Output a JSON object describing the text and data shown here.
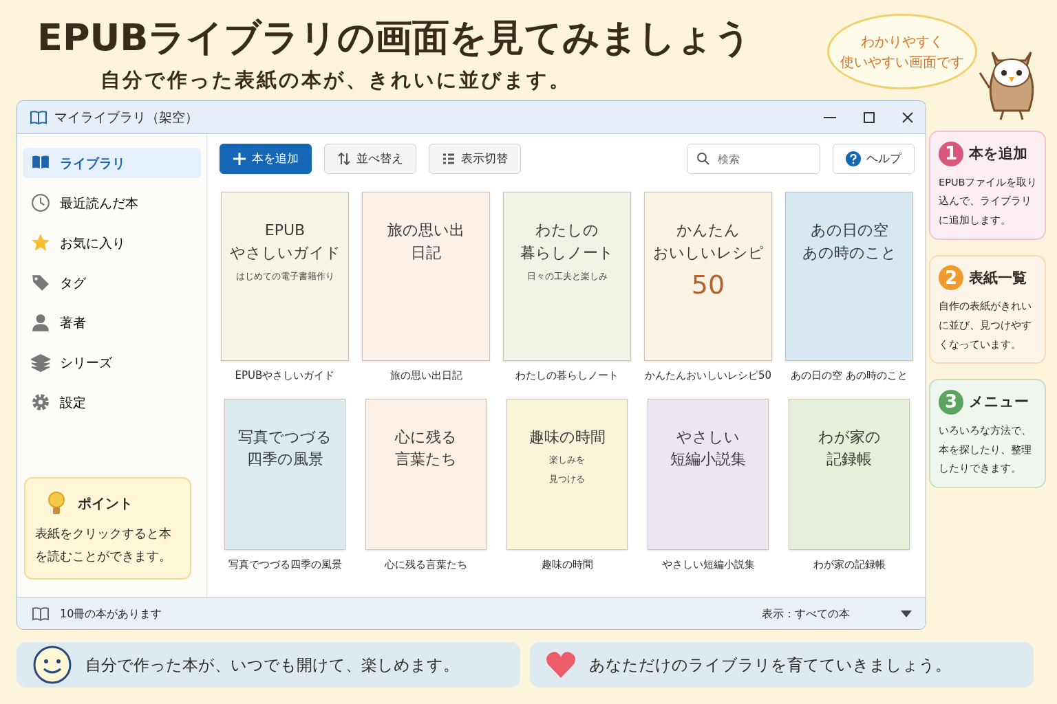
{
  "header": {
    "title": "EPUBライブラリの画面を見てみましょう",
    "subtitle": "自分で作った表紙の本が、きれいに並びます。",
    "bubble": [
      "わかりやすく",
      "使いやすい画面です"
    ]
  },
  "window": {
    "title": "マイライブラリ（架空）"
  },
  "sidebar": {
    "items": [
      {
        "label": "ライブラリ",
        "selected": true
      },
      {
        "label": "最近読んだ本",
        "selected": false
      },
      {
        "label": "お気に入り",
        "selected": false
      },
      {
        "label": "タグ",
        "selected": false
      },
      {
        "label": "著者",
        "selected": false
      },
      {
        "label": "シリーズ",
        "selected": false
      },
      {
        "label": "設定",
        "selected": false
      }
    ],
    "tip": {
      "title": "ポイント",
      "text": "表紙をクリックすると本を読むことができます。"
    }
  },
  "toolbar": {
    "buttons": [
      {
        "label": "本を追加",
        "kind": "primary"
      },
      {
        "label": "並べ替え",
        "kind": "sort"
      },
      {
        "label": "表示切替",
        "kind": "view"
      }
    ],
    "search": {
      "placeholder": "検索"
    },
    "help": "ヘルプ"
  },
  "books": [
    {
      "label": "EPUBやさしいガイド",
      "color": "#f7f4e6",
      "lines": [
        {
          "text": "EPUB",
          "kind": "title"
        },
        {
          "text": "やさしいガイド",
          "kind": "title"
        },
        {
          "text": "はじめての電子書籍作り",
          "kind": "sub"
        }
      ]
    },
    {
      "label": "旅の思い出日記",
      "color": "#fbf1e8",
      "lines": [
        {
          "text": "旅の思い出",
          "kind": "title"
        },
        {
          "text": "日記",
          "kind": "title"
        }
      ]
    },
    {
      "label": "わたしの暮らしノート",
      "color": "#eef3e6",
      "lines": [
        {
          "text": "わたしの",
          "kind": "title"
        },
        {
          "text": "暮らしノート",
          "kind": "title"
        },
        {
          "text": "日々の工夫と楽しみ",
          "kind": "sub"
        }
      ]
    },
    {
      "label": "かんたんおいしいレシピ50",
      "color": "#fbf3e6",
      "lines": [
        {
          "text": "かんたん",
          "kind": "title"
        },
        {
          "text": "おいしいレシピ",
          "kind": "title"
        },
        {
          "text": "50",
          "kind": "big"
        }
      ]
    },
    {
      "label": "あの日の空 あの時のこと",
      "color": "#d6e8f1",
      "lines": [
        {
          "text": "あの日の空",
          "kind": "title"
        },
        {
          "text": "あの時のこと",
          "kind": "title"
        }
      ]
    },
    {
      "label": "写真でつづる四季の風景",
      "color": "#dcebf0",
      "lines": [
        {
          "text": "写真でつづる",
          "kind": "title"
        },
        {
          "text": "四季の風景",
          "kind": "title"
        }
      ]
    },
    {
      "label": "心に残る言葉たち",
      "color": "#fbefe6",
      "lines": [
        {
          "text": "心に残る",
          "kind": "title"
        },
        {
          "text": "言葉たち",
          "kind": "title"
        }
      ]
    },
    {
      "label": "趣味の時間",
      "color": "#f8f5d8",
      "lines": [
        {
          "text": "趣味の時間",
          "kind": "title"
        },
        {
          "text": "楽しみを",
          "kind": "sub"
        },
        {
          "text": "見つける",
          "kind": "sub"
        }
      ]
    },
    {
      "label": "やさしい短編小説集",
      "color": "#ece6f3",
      "lines": [
        {
          "text": "やさしい",
          "kind": "title"
        },
        {
          "text": "短編小説集",
          "kind": "title"
        }
      ]
    },
    {
      "label": "わが家の記録帳",
      "color": "#e6efd8",
      "lines": [
        {
          "text": "わが家の",
          "kind": "title"
        },
        {
          "text": "記録帳",
          "kind": "title"
        }
      ]
    }
  ],
  "status_bar": {
    "count": "10冊の本があります",
    "view": "表示：すべての本"
  },
  "callouts": [
    {
      "number": "1",
      "title": "本を追加",
      "text": "EPUBファイルを取り込んで、ライブラリに追加します。",
      "color": "#d9577f"
    },
    {
      "number": "2",
      "title": "表紙一覧",
      "text": "自作の表紙がきれいに並び、見つけやすくなっています。",
      "color": "#ef9a2c"
    },
    {
      "number": "3",
      "title": "メニュー",
      "text": "いろいろな方法で、本を探したり、整理したりできます。",
      "color": "#5aa460"
    }
  ],
  "footer": [
    {
      "text": "自分で作った本が、いつでも開けて、楽しめます。",
      "kind": "smile"
    },
    {
      "text": "あなただけのライブラリを育てていきましょう。",
      "kind": "heart"
    }
  ]
}
